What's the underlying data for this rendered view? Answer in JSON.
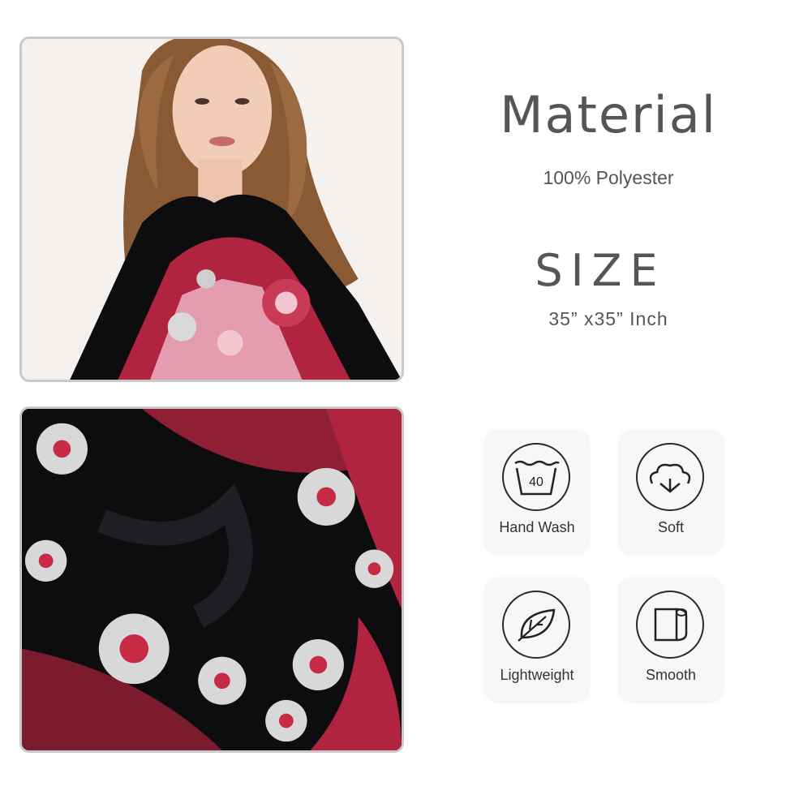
{
  "material": {
    "title": "Material",
    "value": "100% Polyester"
  },
  "size": {
    "title": "SIZE",
    "value": "35”  x35”  Inch"
  },
  "features": [
    {
      "label": "Hand Wash",
      "icon": "hand-wash-icon",
      "icon_text": "40"
    },
    {
      "label": "Soft",
      "icon": "cotton-icon"
    },
    {
      "label": "Lightweight",
      "icon": "leaf-icon"
    },
    {
      "label": "Smooth",
      "icon": "fabric-roll-icon"
    }
  ],
  "colors": {
    "text": "#555555",
    "scarf_black": "#0d0d0f",
    "scarf_red": "#b0243f",
    "scarf_pink": "#e59bb0"
  }
}
